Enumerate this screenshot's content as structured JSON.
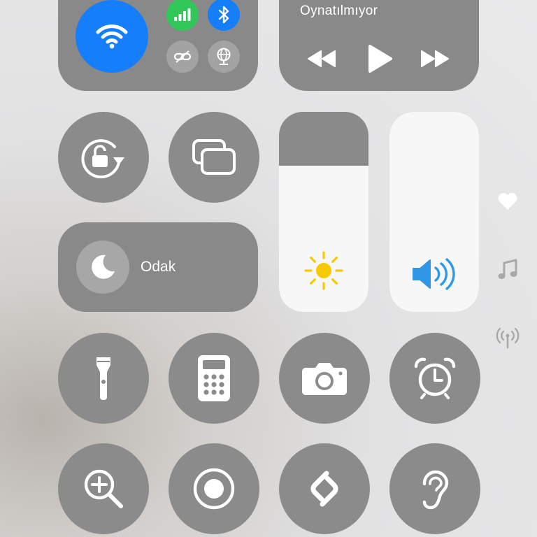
{
  "connectivity": {
    "wifi": {
      "icon": "wifi-icon",
      "active": true,
      "color": "#147efb"
    },
    "cellular": {
      "icon": "cellular-signal-icon",
      "active": true,
      "color": "#32c759"
    },
    "bluetooth": {
      "icon": "bluetooth-icon",
      "active": true,
      "color": "#147efb"
    },
    "hotspot": {
      "icon": "personal-hotspot-link-icon",
      "active": false
    },
    "vpn": {
      "icon": "globe-network-icon",
      "active": false
    }
  },
  "media": {
    "status": "Oynatılmıyor",
    "controls": [
      "rewind-icon",
      "play-icon",
      "fast-forward-icon"
    ]
  },
  "sliders": {
    "brightness": {
      "level": 0.73,
      "icon": "sun-icon",
      "icon_color": "#f7c900"
    },
    "volume": {
      "level": 1.0,
      "icon": "speaker-volume-icon",
      "icon_color": "#2f98e6"
    }
  },
  "focus": {
    "label": "Odak",
    "icon": "moon-icon"
  },
  "toggles": {
    "rotation_lock": "rotation-lock-icon",
    "screen_mirroring": "screen-mirroring-icon",
    "flashlight": "flashlight-icon",
    "calculator": "calculator-icon",
    "camera": "camera-icon",
    "alarm": "alarm-clock-icon",
    "magnifier": "magnifier-icon",
    "screen_recording": "screen-record-icon",
    "shazam": "shazam-icon",
    "hearing": "hearing-ear-icon"
  },
  "side_pages": [
    "heart-icon",
    "music-note-icon",
    "antenna-signal-icon"
  ],
  "colors": {
    "tile": "#898989",
    "slider_fill": "#f7f7f7",
    "text": "#ffffff"
  }
}
